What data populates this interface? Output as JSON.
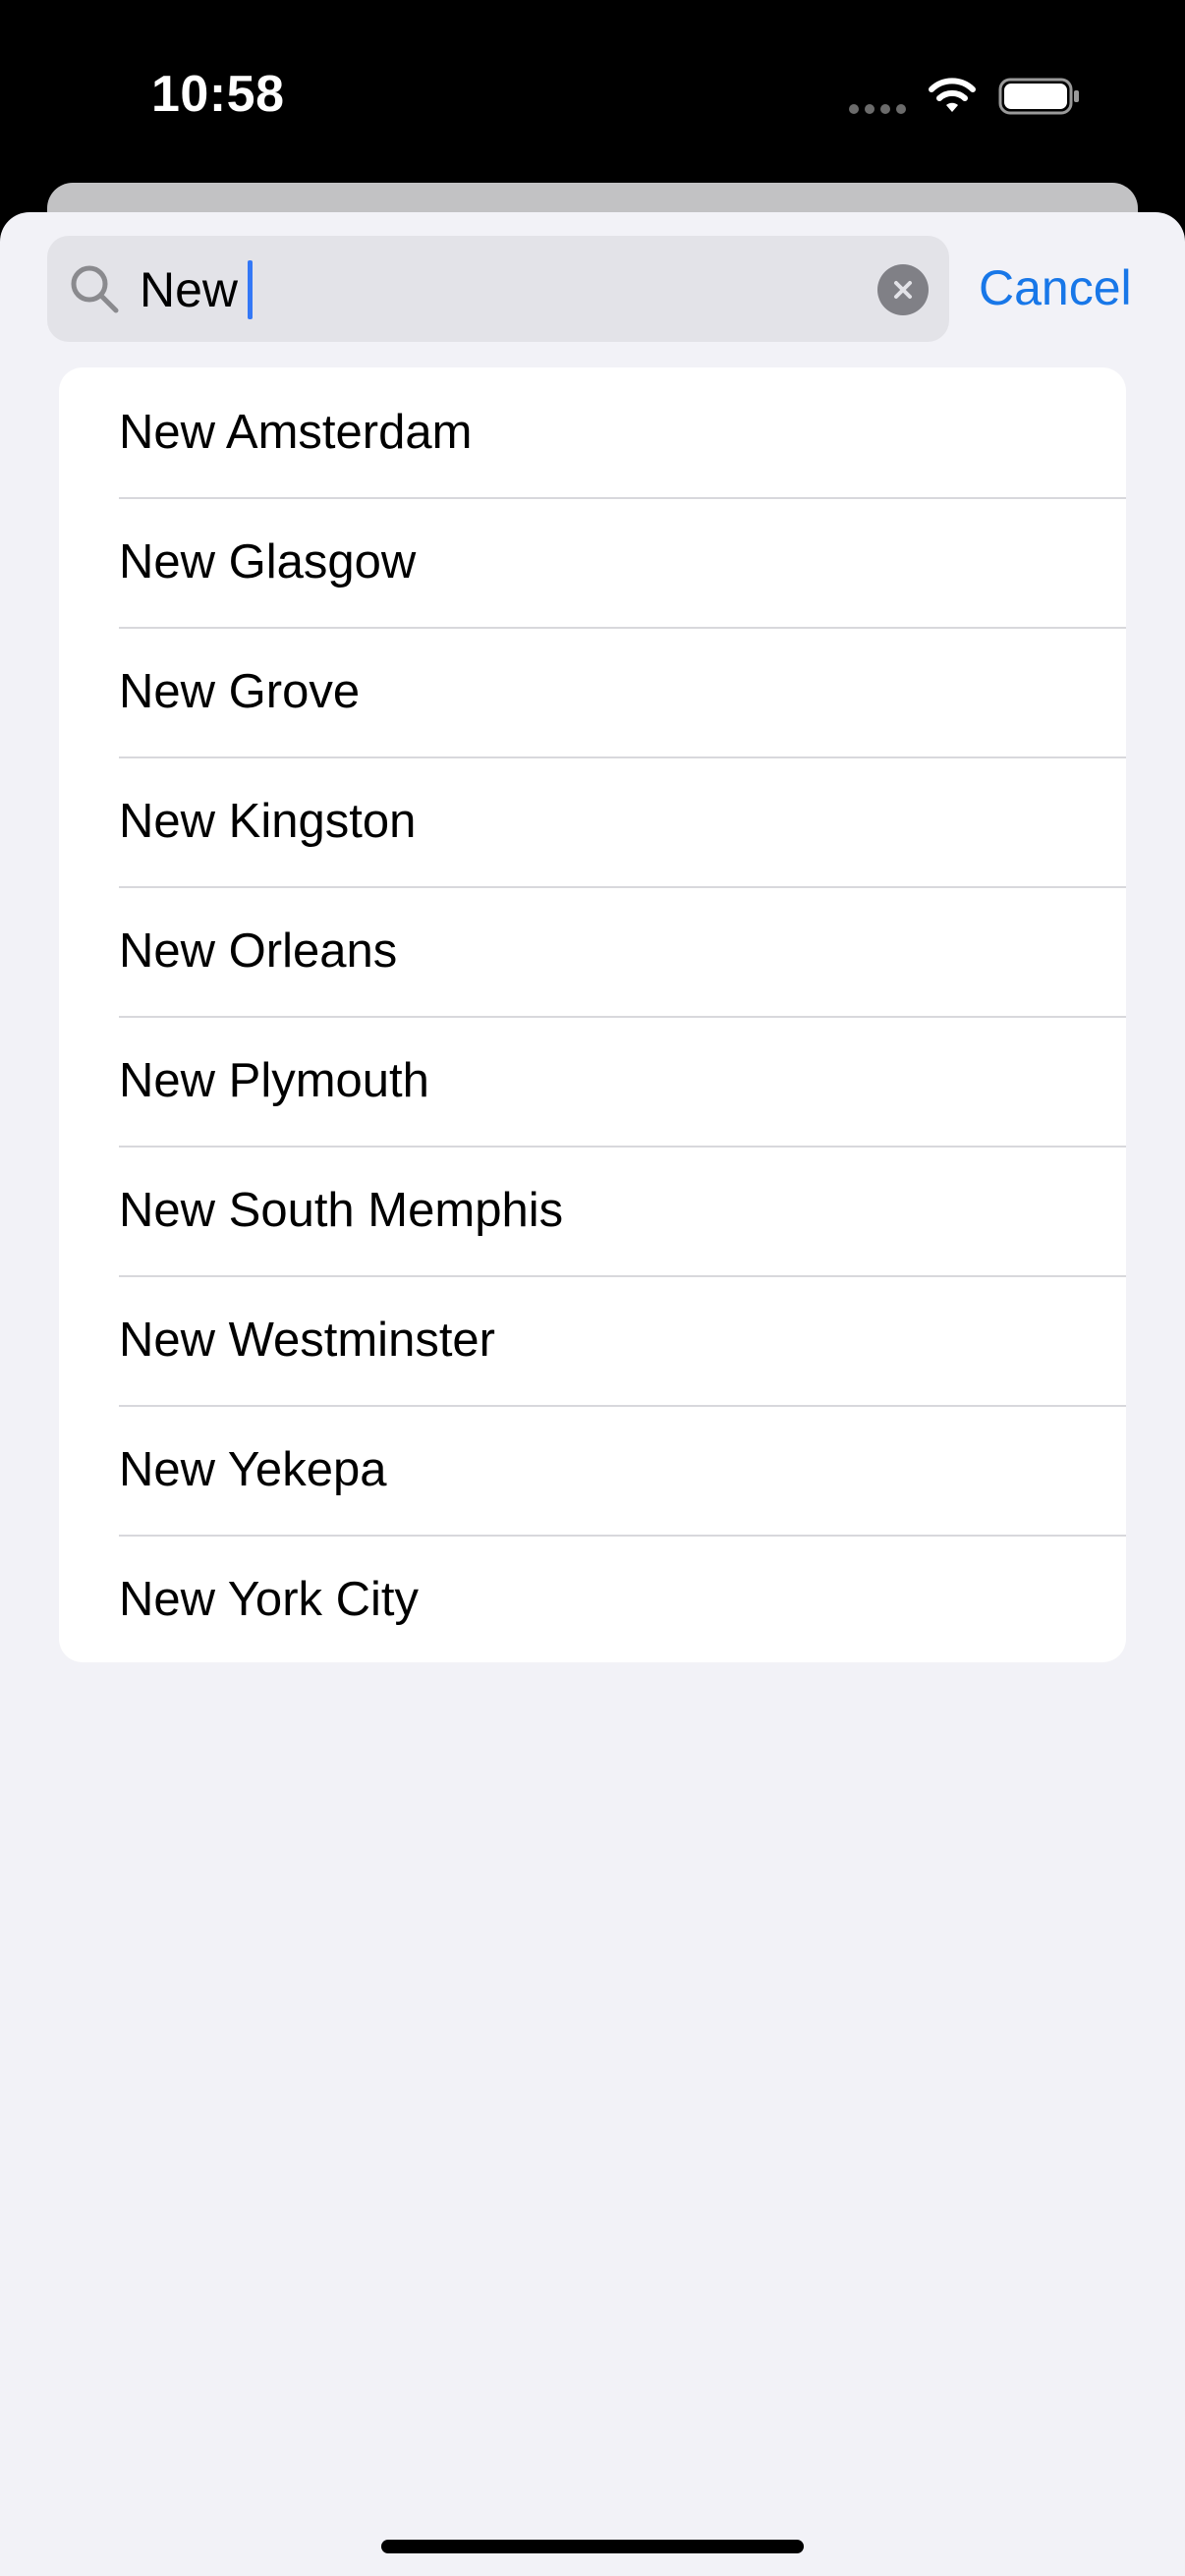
{
  "status_bar": {
    "time": "10:58"
  },
  "search": {
    "query": "New",
    "cancel_label": "Cancel"
  },
  "results": [
    {
      "label": "New Amsterdam"
    },
    {
      "label": "New Glasgow"
    },
    {
      "label": "New Grove"
    },
    {
      "label": "New Kingston"
    },
    {
      "label": "New Orleans"
    },
    {
      "label": "New Plymouth"
    },
    {
      "label": "New South Memphis"
    },
    {
      "label": "New Westminster"
    },
    {
      "label": "New Yekepa"
    },
    {
      "label": "New York City"
    }
  ],
  "icons": {
    "search": "search-icon",
    "clear": "clear-icon",
    "wifi": "wifi-icon",
    "battery": "battery-icon",
    "signal": "signal-dots-icon"
  },
  "colors": {
    "accent": "#1877e8",
    "caret": "#3478f6",
    "sheet_background": "#f2f2f7",
    "search_field": "#e3e3e8"
  }
}
